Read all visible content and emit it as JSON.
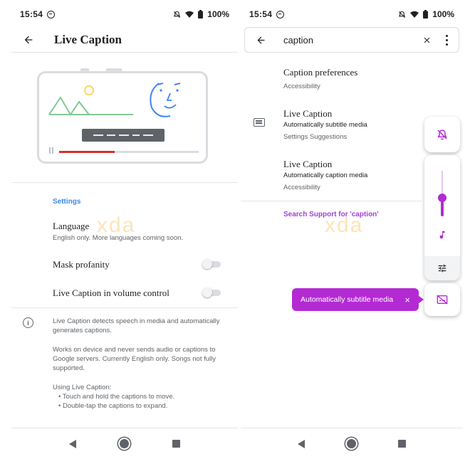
{
  "colors": {
    "accent_purple": "#b32ad3",
    "link_blue": "#1a73e8",
    "progress_red": "#d93025"
  },
  "watermark": "xda",
  "left_screen": {
    "status": {
      "time": "15:54",
      "battery": "100%"
    },
    "appbar": {
      "title": "Live Caption"
    },
    "section_title": "Settings",
    "preferences": [
      {
        "title": "Language",
        "subtitle": "English only. More languages coming soon."
      },
      {
        "title": "Mask profanity",
        "subtitle": "",
        "toggle_on": false
      },
      {
        "title": "Live Caption in volume control",
        "subtitle": "",
        "toggle_on": false
      }
    ],
    "info": {
      "para1": "Live Caption detects speech in media and automatically generates captions.",
      "para2": "Works on device and never sends audio or captions to Google servers. Currently English only. Songs not fully supported.",
      "usage_heading": "Using Live Caption:",
      "usage_items": [
        "• Touch and hold the captions to move.",
        "• Double-tap the captions to expand."
      ]
    },
    "illustration": {
      "playback_progress": 0.4
    }
  },
  "right_screen": {
    "status": {
      "time": "15:54",
      "battery": "100%"
    },
    "search": {
      "query": "caption"
    },
    "results": [
      {
        "title": "Caption preferences",
        "subtitle": "",
        "source": "Accessibility"
      },
      {
        "title": "Live Caption",
        "subtitle": "Automatically subtitle media",
        "source": "Settings Suggestions"
      },
      {
        "title": "Live Caption",
        "subtitle": "Automatically caption media",
        "source": "Accessibility"
      }
    ],
    "support_link": "Search Support for 'caption'",
    "volume": {
      "level": 0.4
    },
    "tooltip": {
      "text": "Automatically subtitle media",
      "close": "×"
    }
  }
}
